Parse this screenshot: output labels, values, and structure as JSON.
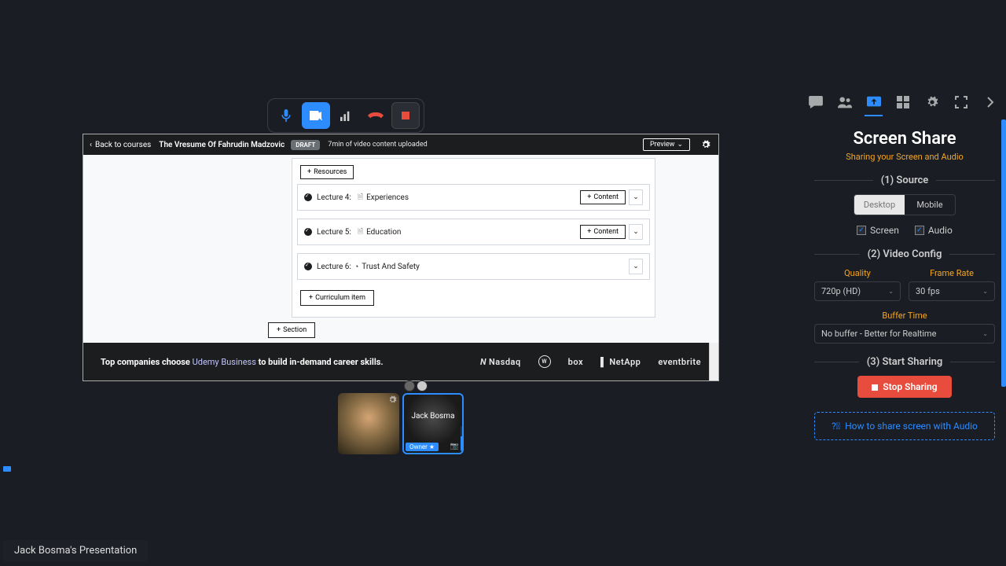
{
  "toolbar": {
    "mic": "microphone",
    "camera": "camera-off",
    "signal": "signal",
    "hangup": "hangup",
    "record": "record"
  },
  "shared": {
    "back": "Back to courses",
    "title": "The Vresume Of Fahrudin Madzovic",
    "draft": "DRAFT",
    "status": "7min of video content uploaded",
    "preview": "Preview",
    "resources": "Resources",
    "lectures": [
      {
        "num": "Lecture 4:",
        "name": "Experiences",
        "hasContent": true
      },
      {
        "num": "Lecture 5:",
        "name": "Education",
        "hasContent": true
      },
      {
        "num": "Lecture 6:",
        "name": "Trust And Safety",
        "hasContent": false
      }
    ],
    "content": "Content",
    "addItem": "Curriculum item",
    "addSection": "Section",
    "footer": {
      "pre": "Top companies choose ",
      "link": "Udemy Business",
      "post": " to build in-demand career skills."
    },
    "logos": {
      "nasdaq": "Nasdaq",
      "vw": "W",
      "box": "box",
      "netapp": "NetApp",
      "eventbrite": "eventbrite"
    }
  },
  "participants": {
    "name": "Jack Bosma",
    "owner_badge": "Owner ★"
  },
  "panel": {
    "title": "Screen Share",
    "subtitle": "Sharing your Screen and Audio",
    "section1": "(1) Source",
    "desktop": "Desktop",
    "mobile": "Mobile",
    "screen": "Screen",
    "audio": "Audio",
    "section2": "(2) Video Config",
    "quality_label": "Quality",
    "quality_value": "720p (HD)",
    "framerate_label": "Frame Rate",
    "framerate_value": "30 fps",
    "buffer_label": "Buffer Time",
    "buffer_value": "No buffer - Better for Realtime",
    "section3": "(3) Start Sharing",
    "stop": "Stop Sharing",
    "howto": "How to share screen with Audio"
  },
  "bottom_title": "Jack Bosma's Presentation"
}
